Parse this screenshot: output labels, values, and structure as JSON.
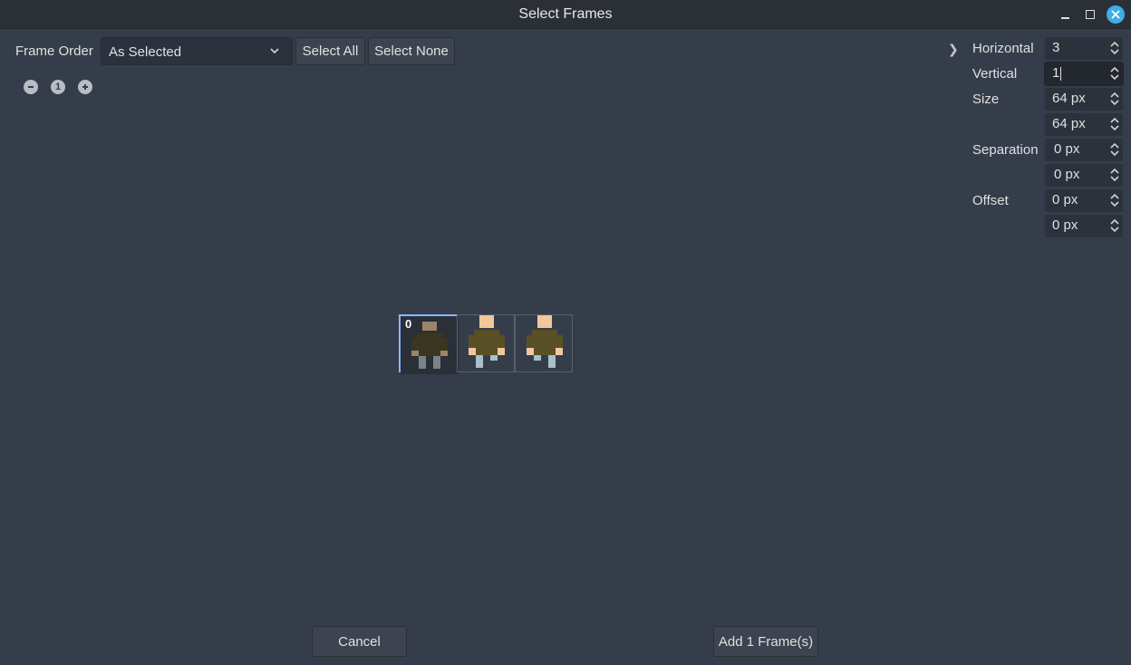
{
  "window": {
    "title": "Select Frames",
    "controls": [
      "minimize-icon",
      "maximize-icon",
      "close-icon"
    ]
  },
  "toolbar": {
    "frame_order_label": "Frame Order",
    "frame_order_value": "As Selected",
    "select_all_label": "Select All",
    "select_none_label": "Select None"
  },
  "zoom": {
    "zoom_out_icon": "minus-circle-icon",
    "reset_label": "1",
    "zoom_in_icon": "plus-circle-icon"
  },
  "settings": {
    "collapse_glyph": "❯",
    "horizontal_label": "Horizontal",
    "horizontal_value": "3",
    "vertical_label": "Vertical",
    "vertical_value": "1",
    "size_label": "Size",
    "size_x": "64 px",
    "size_y": "64 px",
    "separation_label": "Separation",
    "separation_x": "0 px",
    "separation_y": "0 px",
    "offset_label": "Offset",
    "offset_x": "0 px",
    "offset_y": "0 px"
  },
  "frames": [
    {
      "index_label": "0",
      "selected": true
    },
    {
      "index_label": "",
      "selected": false
    },
    {
      "index_label": "",
      "selected": false
    }
  ],
  "footer": {
    "cancel_label": "Cancel",
    "add_label": "Add 1 Frame(s)"
  },
  "colors": {
    "background": "#363d4a",
    "selection": "#8ab8ff",
    "close_button": "#3daee9"
  }
}
